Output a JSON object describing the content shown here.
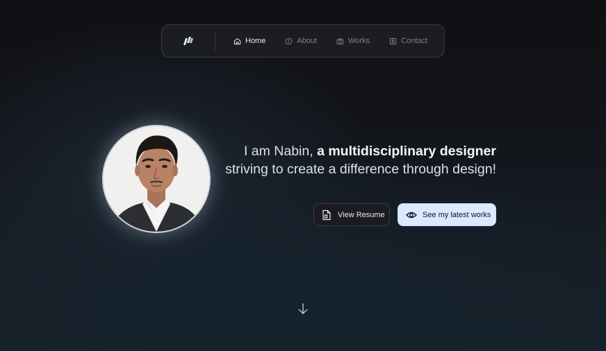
{
  "nav": {
    "logo": "logo-icon",
    "items": [
      {
        "label": "Home",
        "icon": "home-icon",
        "active": true
      },
      {
        "label": "About",
        "icon": "info-icon",
        "active": false
      },
      {
        "label": "Works",
        "icon": "briefcase-icon",
        "active": false
      },
      {
        "label": "Contact",
        "icon": "contact-card-icon",
        "active": false
      }
    ]
  },
  "hero": {
    "intro": "I am Nabin, ",
    "highlight": "a multidisciplinary designer",
    "rest": "striving to create a difference through design!"
  },
  "buttons": {
    "resume": "View Resume",
    "works": "See my latest works"
  },
  "colors": {
    "accent_button": "#dbe9ff",
    "background": "#121419"
  }
}
